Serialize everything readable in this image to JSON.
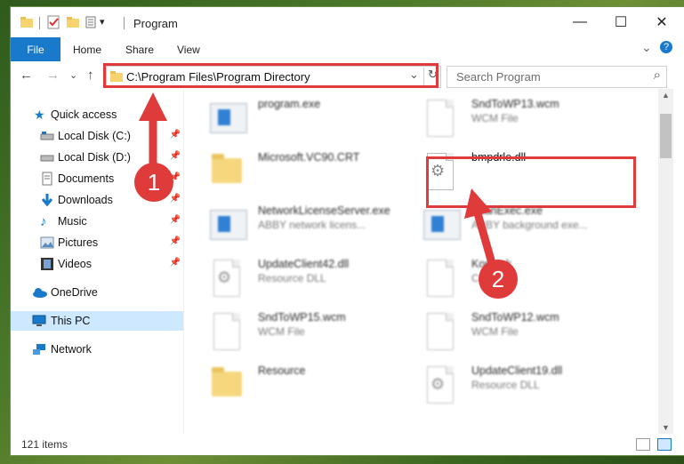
{
  "window": {
    "title": "Program"
  },
  "controls": {
    "minimize": "—",
    "maximize": "☐",
    "close": "✕"
  },
  "ribbon": {
    "file": "File",
    "tabs": [
      "Home",
      "Share",
      "View"
    ],
    "expand": "⌄",
    "help": "?"
  },
  "nav": {
    "back": "←",
    "forward": "→",
    "recent": "⌄",
    "up": "↑"
  },
  "address": {
    "path": "C:\\Program Files\\Program Directory",
    "dropdown": "⌄",
    "refresh": "↻"
  },
  "search": {
    "placeholder": "Search Program",
    "icon": "⌕"
  },
  "sidebar": {
    "quick_access": "Quick access",
    "items": [
      {
        "label": "Local Disk (C:)",
        "icon": "drive-icon"
      },
      {
        "label": "Local Disk (D:)",
        "icon": "drive-icon"
      },
      {
        "label": "Documents",
        "icon": "documents-icon"
      },
      {
        "label": "Downloads",
        "icon": "downloads-icon"
      },
      {
        "label": "Music",
        "icon": "music-icon"
      },
      {
        "label": "Pictures",
        "icon": "pictures-icon"
      },
      {
        "label": "Videos",
        "icon": "videos-icon"
      }
    ],
    "onedrive": "OneDrive",
    "thispc": "This PC",
    "network": "Network"
  },
  "files": [
    {
      "name": "program.exe",
      "type": ""
    },
    {
      "name": "SndToWP13.wcm",
      "type": "WCM File"
    },
    {
      "name": "Microsoft.VC90.CRT",
      "type": ""
    },
    {
      "name": "bmpdrle.dll",
      "type": ""
    },
    {
      "name": "NetworkLicenseServer.exe",
      "type": "ABBY network licens..."
    },
    {
      "name": "ScanExec.exe",
      "type": "ABBY background exe..."
    },
    {
      "name": "UpdateClient42.dll",
      "type": "Resource DLL"
    },
    {
      "name": "Kor....ck",
      "type": "C..."
    },
    {
      "name": "SndToWP15.wcm",
      "type": "WCM File"
    },
    {
      "name": "SndToWP12.wcm",
      "type": "WCM File"
    },
    {
      "name": "Resource",
      "type": ""
    },
    {
      "name": "UpdateClient19.dll",
      "type": "Resource DLL"
    }
  ],
  "badges": [
    "1",
    "2"
  ],
  "status": {
    "count": "121 items"
  },
  "colors": {
    "accent": "#1979ca",
    "highlight": "#e03b3b",
    "selected": "#cde8ff"
  }
}
